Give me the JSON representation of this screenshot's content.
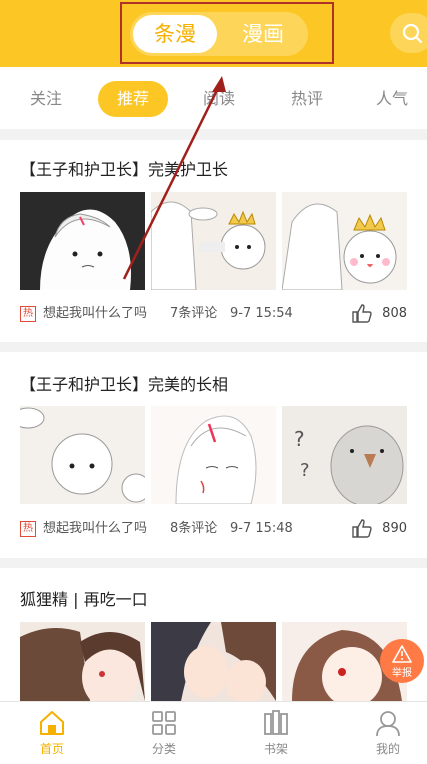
{
  "header": {
    "segments": [
      "条漫",
      "漫画"
    ],
    "active_segment": "条漫",
    "search_icon": "search-icon",
    "accent": "#fcc624"
  },
  "tabs": [
    "关注",
    "推荐",
    "阅读",
    "热评",
    "人气"
  ],
  "active_tab": "推荐",
  "feed": [
    {
      "title": "【王子和护卫长】完美护卫长",
      "badge": "热",
      "author": "想起我叫什么了吗",
      "comments": "7条评论",
      "time": "9-7 15:54",
      "likes": "808"
    },
    {
      "title": "【王子和护卫长】完美的长相",
      "badge": "热",
      "author": "想起我叫什么了吗",
      "comments": "8条评论",
      "time": "9-7 15:48",
      "likes": "890"
    },
    {
      "title": "狐狸精 | 再吃一口"
    }
  ],
  "report": {
    "label": "举报",
    "icon": "warning-icon"
  },
  "bottom_nav": [
    {
      "label": "首页",
      "icon": "home-icon"
    },
    {
      "label": "分类",
      "icon": "grid-icon"
    },
    {
      "label": "书架",
      "icon": "bookshelf-icon"
    },
    {
      "label": "我的",
      "icon": "user-icon"
    }
  ],
  "active_nav": "首页"
}
